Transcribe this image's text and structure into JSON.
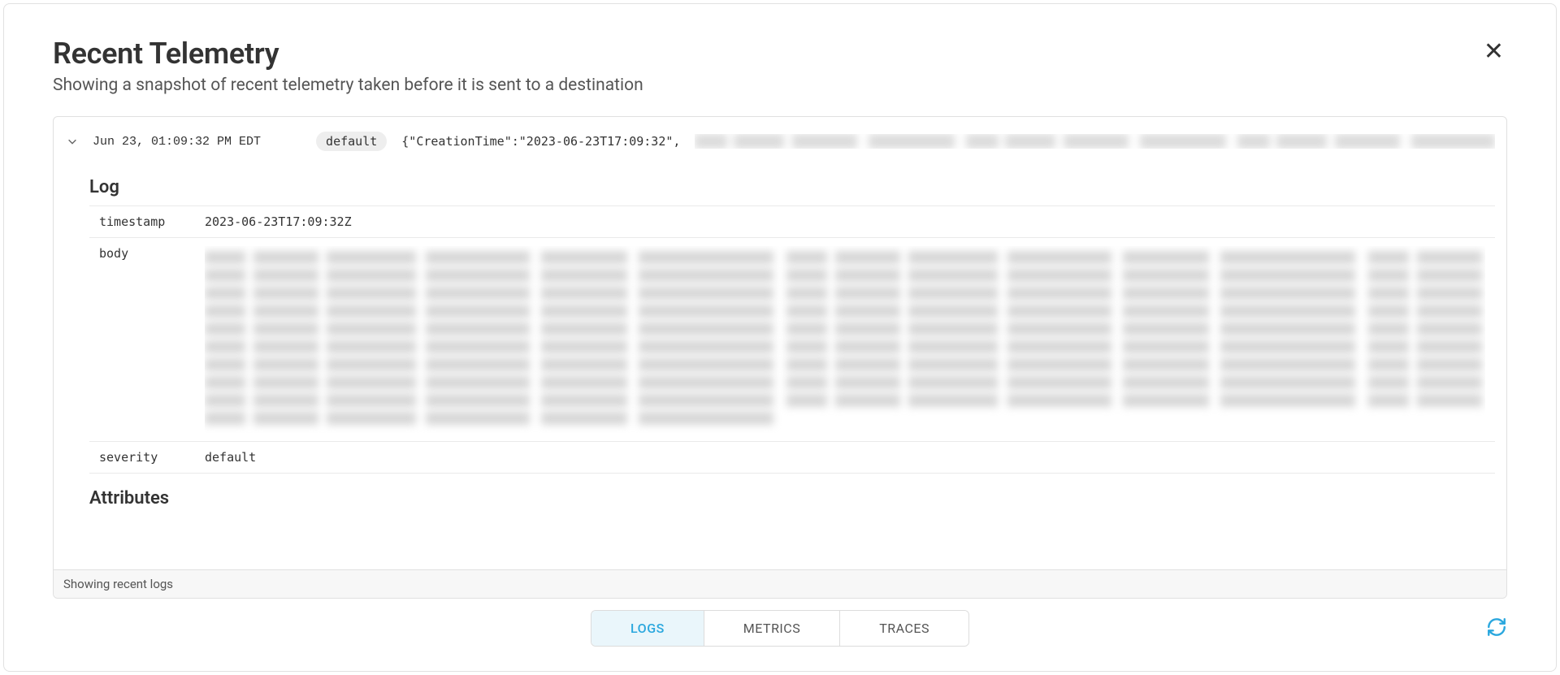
{
  "header": {
    "title": "Recent Telemetry",
    "subtitle": "Showing a snapshot of recent telemetry taken before it is sent to a destination"
  },
  "entry": {
    "timestamp_display": "Jun 23, 01:09:32 PM EDT",
    "severity_badge": "default",
    "preview_json": "{\"CreationTime\":\"2023-06-23T17:09:32\","
  },
  "log": {
    "section_label": "Log",
    "fields": {
      "timestamp": {
        "key": "timestamp",
        "value": "2023-06-23T17:09:32Z"
      },
      "body": {
        "key": "body"
      },
      "severity": {
        "key": "severity",
        "value": "default"
      }
    },
    "attributes_label": "Attributes"
  },
  "footer": {
    "status_text": "Showing recent logs"
  },
  "tabs": {
    "logs": "LOGS",
    "metrics": "METRICS",
    "traces": "TRACES"
  }
}
